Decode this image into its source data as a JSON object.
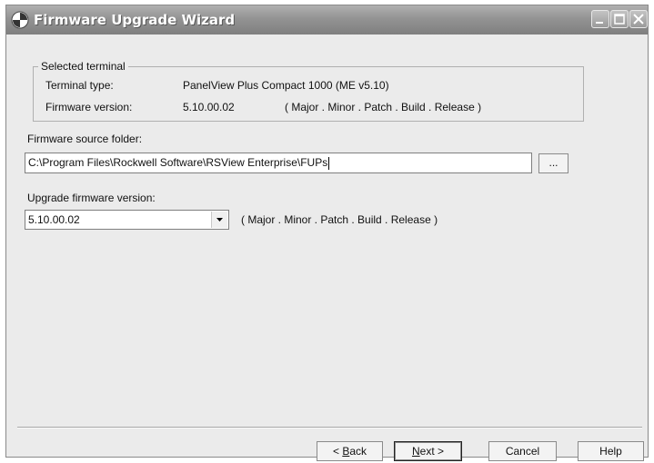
{
  "window": {
    "title": "Firmware Upgrade Wizard"
  },
  "selected_terminal": {
    "legend": "Selected terminal",
    "type_label": "Terminal type:",
    "type_value": "PanelView Plus Compact  1000  (ME v5.10)",
    "fw_label": "Firmware version:",
    "fw_value": "5.10.00.02",
    "fw_format": "( Major . Minor . Patch . Build . Release )"
  },
  "source": {
    "label": "Firmware source folder:",
    "value": "C:\\Program Files\\Rockwell Software\\RSView Enterprise\\FUPs",
    "browse_label": "..."
  },
  "upgrade": {
    "label": "Upgrade firmware version:",
    "selected": "5.10.00.02",
    "format": "( Major . Minor . Patch . Build . Release )"
  },
  "buttons": {
    "back_pre": "< ",
    "back_key": "B",
    "back_post": "ack",
    "next_key": "N",
    "next_post": "ext >",
    "cancel": "Cancel",
    "help": "Help"
  }
}
